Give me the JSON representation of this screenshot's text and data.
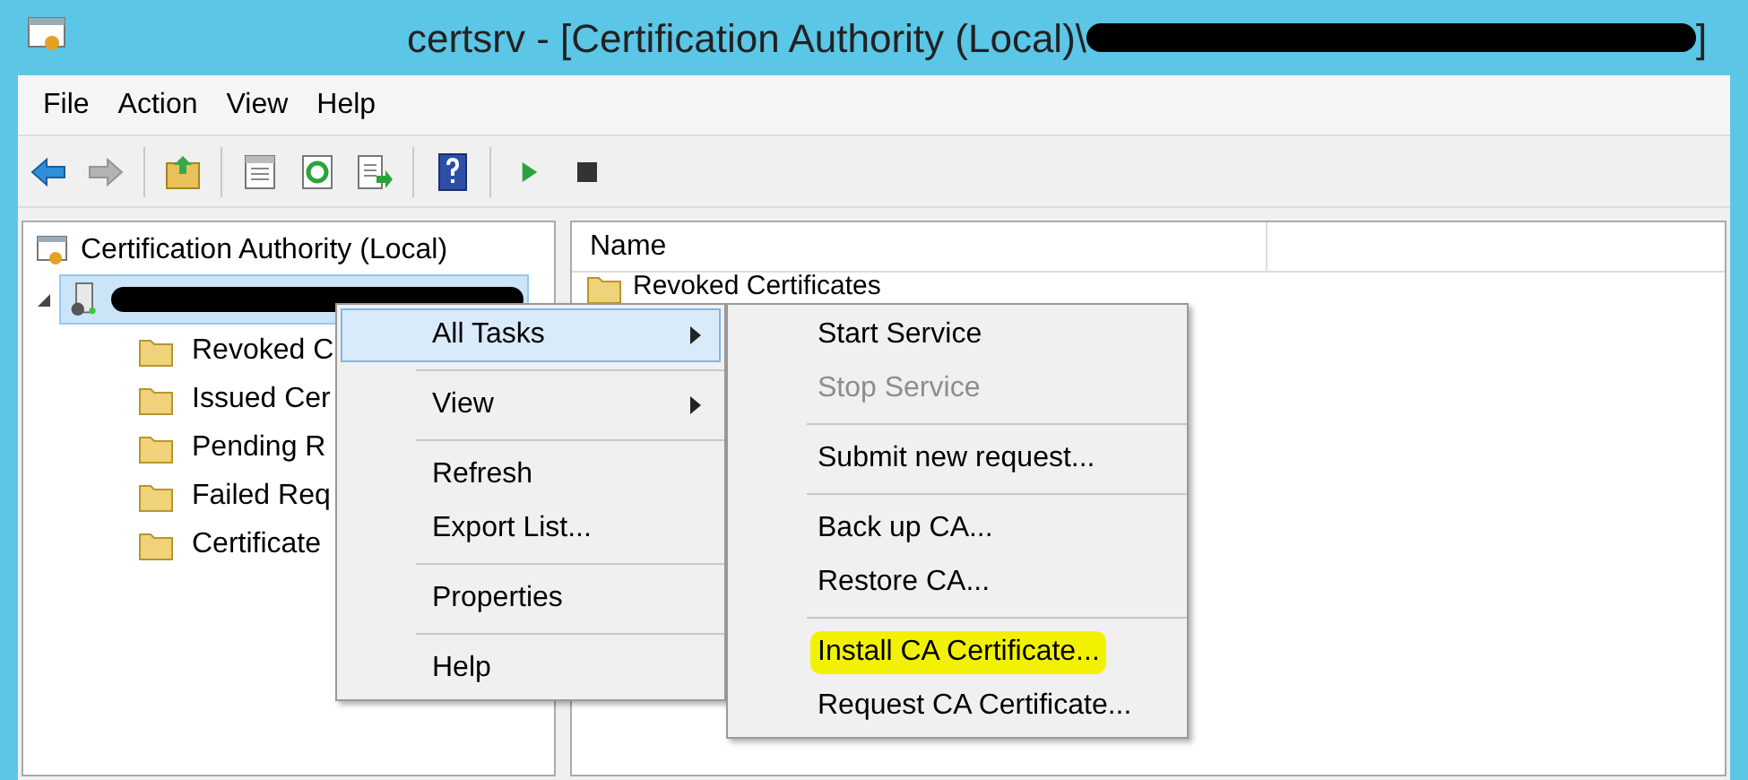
{
  "window": {
    "title": "certsrv - [Certification Authority (Local)\\",
    "title_redacted": true,
    "title_end": "]"
  },
  "menu_bar": [
    "File",
    "Action",
    "View",
    "Help"
  ],
  "toolbar": [
    {
      "kind": "back",
      "disabled": false
    },
    {
      "kind": "forward",
      "disabled": true
    },
    {
      "kind": "separator"
    },
    {
      "kind": "up",
      "disabled": false
    },
    {
      "kind": "separator"
    },
    {
      "kind": "properties",
      "disabled": false
    },
    {
      "kind": "refresh",
      "disabled": false
    },
    {
      "kind": "export",
      "disabled": false
    },
    {
      "kind": "separator"
    },
    {
      "kind": "help",
      "disabled": false
    },
    {
      "kind": "separator"
    },
    {
      "kind": "start",
      "disabled": false
    },
    {
      "kind": "stop",
      "disabled": false
    }
  ],
  "tree": {
    "label": "Certification Authority (Local)",
    "children": [
      {
        "kind": "server",
        "redacted": true,
        "selected": true,
        "expanded": true,
        "children": [
          {
            "label": "Revoked C"
          },
          {
            "label": "Issued Cer"
          },
          {
            "label": "Pending R"
          },
          {
            "label": "Failed Req"
          },
          {
            "label": "Certificate"
          }
        ]
      }
    ]
  },
  "list": {
    "columns": [
      "Name"
    ],
    "rows": [
      "Revoked Certificates"
    ]
  },
  "context_menu": {
    "items": [
      {
        "kind": "item",
        "label": "All Tasks",
        "submenu": true,
        "selected": true
      },
      {
        "kind": "separator"
      },
      {
        "kind": "item",
        "label": "View",
        "submenu": true,
        "selected": false
      },
      {
        "kind": "separator"
      },
      {
        "kind": "item",
        "label": "Refresh",
        "submenu": false,
        "selected": false
      },
      {
        "kind": "item",
        "label": "Export List...",
        "submenu": false,
        "selected": false
      },
      {
        "kind": "separator"
      },
      {
        "kind": "item",
        "label": "Properties",
        "submenu": false,
        "selected": false
      },
      {
        "kind": "separator"
      },
      {
        "kind": "item",
        "label": "Help",
        "submenu": false,
        "selected": false
      }
    ]
  },
  "submenu": {
    "items": [
      {
        "kind": "item",
        "label": "Start Service",
        "disabled": false,
        "highlighted": false
      },
      {
        "kind": "item",
        "label": "Stop Service",
        "disabled": true,
        "highlighted": false
      },
      {
        "kind": "separator"
      },
      {
        "kind": "item",
        "label": "Submit new request...",
        "disabled": false,
        "highlighted": false
      },
      {
        "kind": "separator"
      },
      {
        "kind": "item",
        "label": "Back up CA...",
        "disabled": false,
        "highlighted": false
      },
      {
        "kind": "item",
        "label": "Restore CA...",
        "disabled": false,
        "highlighted": false
      },
      {
        "kind": "separator"
      },
      {
        "kind": "item",
        "label": "Install CA Certificate...",
        "disabled": false,
        "highlighted": true
      },
      {
        "kind": "item",
        "label": "Request CA Certificate...",
        "disabled": false,
        "highlighted": false
      }
    ]
  }
}
